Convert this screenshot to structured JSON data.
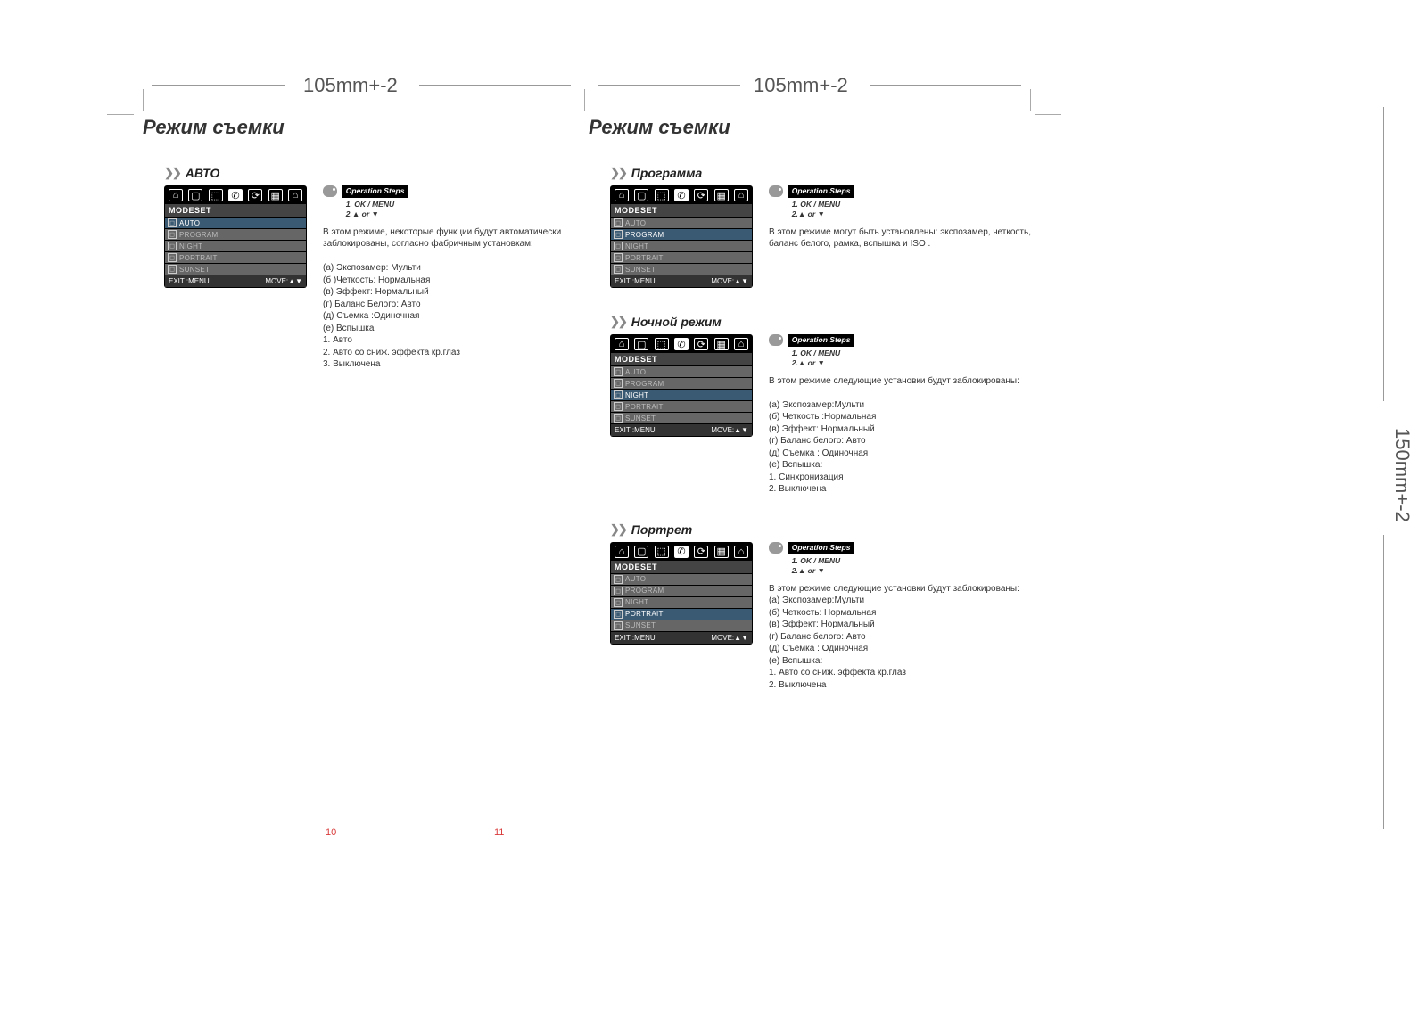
{
  "dimensions": {
    "top_left": "105mm+-2",
    "top_right": "105mm+-2",
    "right": "150mm+-2"
  },
  "left_page": {
    "title": "Режим съемки",
    "page_num": "10",
    "sections": [
      {
        "heading": "АВТО",
        "modeset": {
          "header": "MODESET",
          "rows": [
            "AUTO",
            "PROGRAM",
            "NIGHT",
            "PORTRAIT",
            "SUNSET"
          ],
          "selected": 0,
          "footer_left": "EXIT :MENU",
          "footer_right": "MOVE:▲▼"
        },
        "opsteps": {
          "title": "Operation Steps",
          "line1": "1. OK / MENU",
          "line2": "2.▲  or ▼"
        },
        "text": "В этом режиме, некоторые функции будут автоматически  заблокированы, согласно фабричным установкам:\n\n(а) Экспозамер: Мульти\n(б )Четкость: Нормальная\n(в) Эффект: Нормальный\n(г) Баланс Белого:  Авто\n(д) Съемка :Одиночная\n(е) Вспышка\n     1. Авто\n     2. Авто со сниж. эффекта кр.глаз\n     3. Выключена"
      }
    ]
  },
  "right_page": {
    "title": "Режим съемки",
    "page_num": "11",
    "sections": [
      {
        "heading": "Программа",
        "modeset": {
          "header": "MODESET",
          "rows": [
            "AUTO",
            "PROGRAM",
            "NIGHT",
            "PORTRAIT",
            "SUNSET"
          ],
          "selected": 1,
          "footer_left": "EXIT :MENU",
          "footer_right": "MOVE:▲▼"
        },
        "opsteps": {
          "title": "Operation Steps",
          "line1": "1. OK / MENU",
          "line2": "2.▲  or ▼"
        },
        "text": "В этом режиме могут быть установлены: экспозамер, четкость, баланс белого, рамка, вспышка и ISO ."
      },
      {
        "heading": "Ночной режим",
        "modeset": {
          "header": "MODESET",
          "rows": [
            "AUTO",
            "PROGRAM",
            "NIGHT",
            "PORTRAIT",
            "SUNSET"
          ],
          "selected": 2,
          "footer_left": "EXIT :MENU",
          "footer_right": "MOVE:▲▼"
        },
        "opsteps": {
          "title": "Operation Steps",
          "line1": "1. OK / MENU",
          "line2": "2.▲  or ▼"
        },
        "text": "В этом режиме следующие установки будут заблокированы:\n\n(а) Экспозамер:Мульти\n(б) Четкость  :Нормальная\n(в) Эффект:  Нормальный\n(г) Баланс белого:   Авто\n(д) Съемка : Одиночная\n(е) Вспышка:\n     1. Синхронизация\n     2. Выключена"
      },
      {
        "heading": "Портрет",
        "modeset": {
          "header": "MODESET",
          "rows": [
            "AUTO",
            "PROGRAM",
            "NIGHT",
            "PORTRAIT",
            "SUNSET"
          ],
          "selected": 3,
          "footer_left": "EXIT :MENU",
          "footer_right": "MOVE:▲▼"
        },
        "opsteps": {
          "title": "Operation Steps",
          "line1": "1. OK / MENU",
          "line2": "2.▲  or ▼"
        },
        "text": "В этом режиме следующие установки будут заблокированы:\n(а) Экспозамер:Мульти\n(б) Четкость:  Нормальная\n(в) Эффект:  Нормальный\n(г) Баланс белого:  Авто\n(д) Съемка : Одиночная\n(е) Вспышка:\n    1. Авто со сниж. эффекта кр.глаз\n    2. Выключена"
      }
    ]
  }
}
